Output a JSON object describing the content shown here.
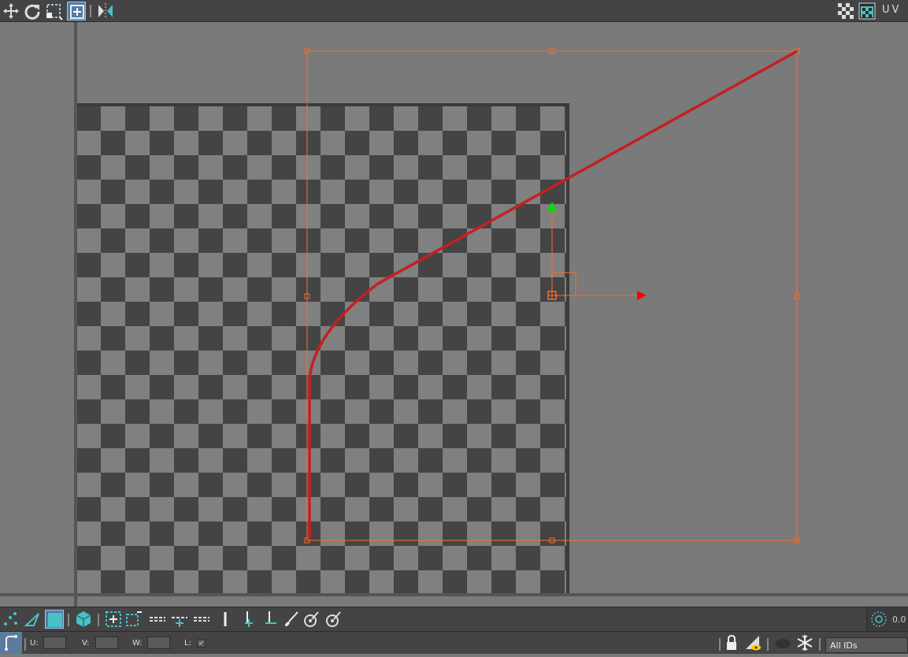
{
  "toolbar_top": {
    "uv_label": "UV",
    "icons": [
      "move-icon",
      "rotate-icon",
      "scale-icon",
      "freeform-icon",
      "mirror-icon",
      "checker-pattern-icon",
      "display-options-icon"
    ]
  },
  "viewport": {
    "accent_color": "#ff6a2b",
    "spline_color": "#c42020",
    "gizmo_x_color": "#ff0000",
    "gizmo_y_color": "#00e000"
  },
  "toolbar_mid": {
    "zoom_value": "0.0"
  },
  "statusbar": {
    "u_label": "U:",
    "v_label": "V:",
    "w_label": "W:",
    "l_label": "L:",
    "u_value": "",
    "v_value": "",
    "w_value": "",
    "l_check": "✔",
    "id_filter": "All IDs"
  }
}
